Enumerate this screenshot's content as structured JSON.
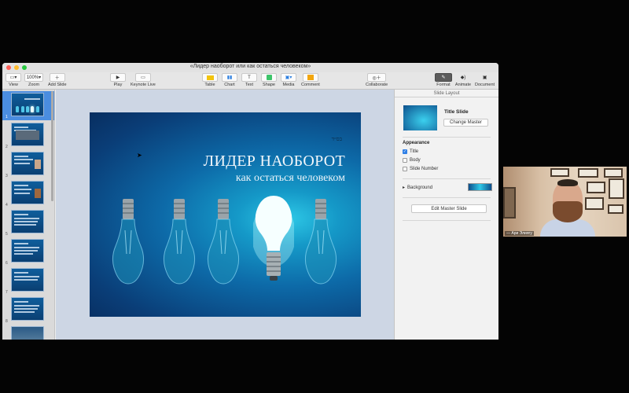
{
  "window": {
    "title": "«Лидер наоборот или как остаться человеком»",
    "traffic_colors": [
      "#ff5f57",
      "#febc2e",
      "#28c840"
    ]
  },
  "toolbar": {
    "view_label": "View",
    "zoom_value": "100%",
    "zoom_label": "Zoom",
    "add_slide_label": "Add Slide",
    "play_label": "Play",
    "keynote_live_label": "Keynote Live",
    "table_label": "Table",
    "chart_label": "Chart",
    "text_label": "Text",
    "shape_label": "Shape",
    "media_label": "Media",
    "comment_label": "Comment",
    "collaborate_label": "Collaborate",
    "format_label": "Format",
    "animate_label": "Animate",
    "document_label": "Document"
  },
  "navigator": {
    "slides": [
      {
        "num": "1",
        "selected": true
      },
      {
        "num": "2",
        "selected": false
      },
      {
        "num": "3",
        "selected": false
      },
      {
        "num": "4",
        "selected": false
      },
      {
        "num": "5",
        "selected": false
      },
      {
        "num": "6",
        "selected": false
      },
      {
        "num": "7",
        "selected": false
      },
      {
        "num": "8",
        "selected": false
      },
      {
        "num": "9",
        "selected": false
      }
    ]
  },
  "slide": {
    "hebrew_mark": "בס״ד",
    "title": "ЛИДЕР НАОБОРОТ",
    "subtitle": "как остаться человеком"
  },
  "inspector": {
    "header": "Slide Layout",
    "master_title": "Title Slide",
    "change_master": "Change Master",
    "appearance_label": "Appearance",
    "title_cb": "Title",
    "title_checked": true,
    "body_cb": "Body",
    "body_checked": false,
    "slide_number_cb": "Slide Number",
    "slide_number_checked": false,
    "background_label": "Background",
    "edit_master": "Edit Master Slide"
  },
  "webcam": {
    "participant_name": "— Ари Элиягу"
  }
}
